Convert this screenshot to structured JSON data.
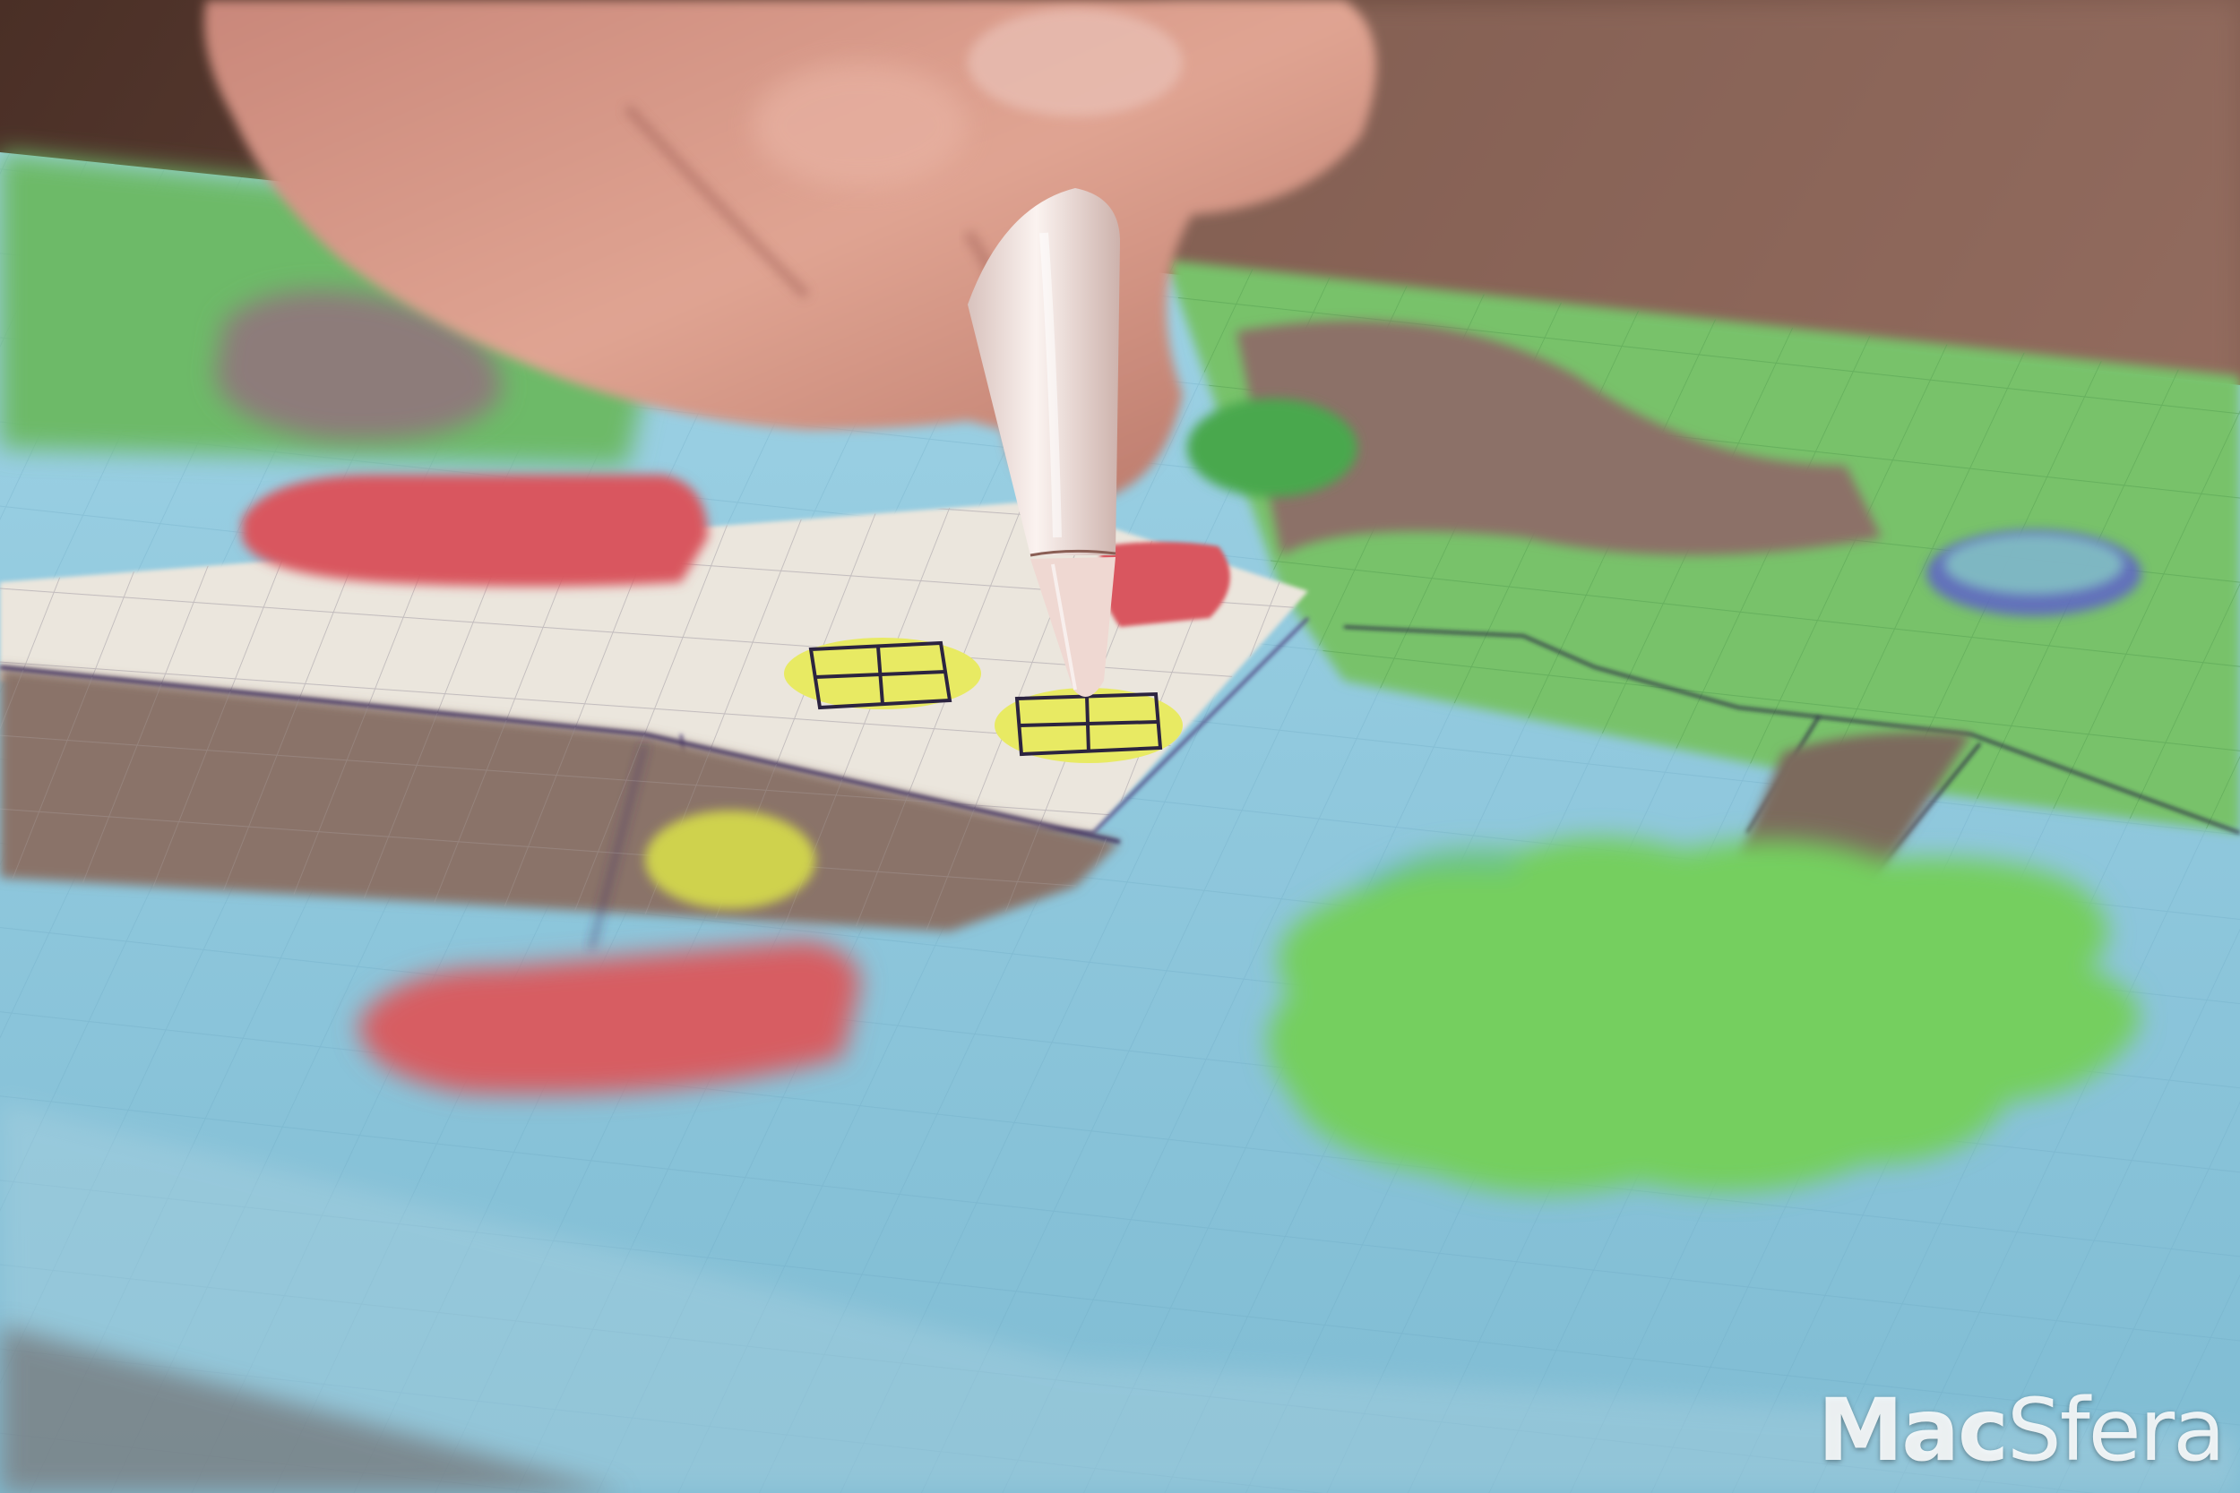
{
  "watermark": {
    "part1": "Mac",
    "part2": "Sfera"
  },
  "subject": {
    "icons": [
      "hand-icon",
      "apple-pencil-icon"
    ]
  },
  "palette": {
    "sky": "#8cc7dc",
    "grass": "#6fb864",
    "house-wall": "#e9e4da",
    "roof": "#8a7369",
    "red-accent": "#d9575e",
    "window-yellow": "#e8ea63",
    "tree-green": "#6fd05b",
    "skin": "#d89a88",
    "pencil": "#f3e6e2"
  }
}
